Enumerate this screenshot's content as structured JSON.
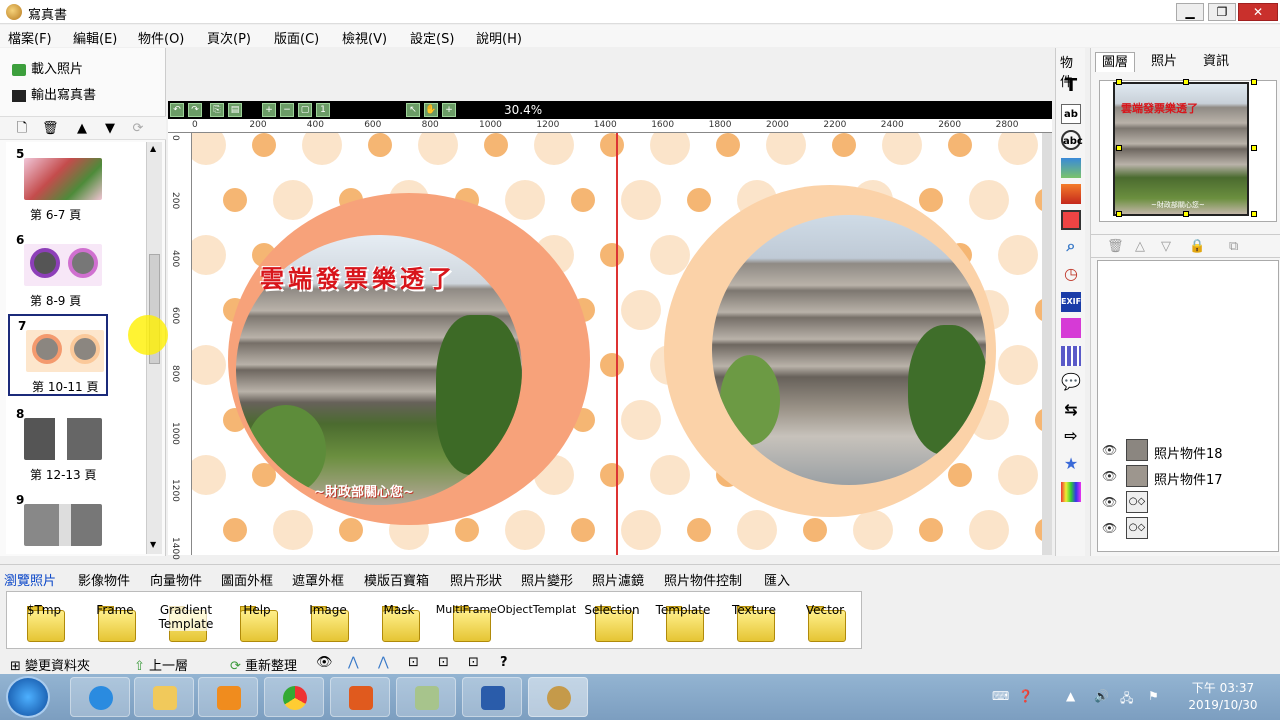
{
  "window": {
    "title": "寫真書"
  },
  "menu": [
    "檔案(F)",
    "編輯(E)",
    "物件(O)",
    "頁次(P)",
    "版面(C)",
    "檢視(V)",
    "設定(S)",
    "說明(H)"
  ],
  "left_actions": {
    "load_photos": "載入照片",
    "export_book": "輸出寫真書"
  },
  "pages": [
    {
      "num": "5",
      "label": "第 6-7 頁"
    },
    {
      "num": "6",
      "label": "第 8-9 頁"
    },
    {
      "num": "7",
      "label": "第 10-11 頁",
      "selected": true
    },
    {
      "num": "8",
      "label": "第 12-13 頁"
    },
    {
      "num": "9",
      "label": ""
    }
  ],
  "editor": {
    "zoom": "30.4%",
    "ruler_h": [
      "0",
      "200",
      "400",
      "600",
      "800",
      "1000",
      "1200",
      "1400",
      "1600",
      "1800",
      "2000",
      "2200",
      "2400",
      "2600",
      "2800"
    ],
    "ruler_v": [
      "0",
      "200",
      "400",
      "600",
      "800",
      "1000",
      "1200",
      "1400"
    ],
    "canvas_title": "雲端發票樂透了",
    "canvas_caption": "~財政部關心您~"
  },
  "right_tabs": [
    "圖層",
    "照片",
    "資訊"
  ],
  "preview": {
    "title": "雲端發票樂透了",
    "caption": "~財政部關心您~"
  },
  "layers": [
    {
      "name": "照片物件18"
    },
    {
      "name": "照片物件17"
    },
    {
      "name": ""
    },
    {
      "name": ""
    }
  ],
  "bottom_tabs": [
    "瀏覽照片",
    "影像物件",
    "向量物件",
    "圖面外框",
    "遮罩外框",
    "模版百寶箱",
    "照片形狀",
    "照片變形",
    "照片濾鏡",
    "照片物件控制",
    "匯入"
  ],
  "folders": [
    "$Tmp",
    "Frame",
    "Gradient Template",
    "Help",
    "Image",
    "Mask",
    "MultiFrameObjectTemplat",
    "Selection",
    "Template",
    "Texture",
    "Vector"
  ],
  "bottom_toolbar": {
    "change_folder": "變更資料夾",
    "up": "上一層",
    "refresh": "重新整理"
  },
  "clock": {
    "time": "下午 03:37",
    "date": "2019/10/30"
  },
  "colors": {
    "canvas_dot_orange": "#f3a95a",
    "canvas_dot_pale": "#fbe1c4",
    "frame_left": "#f7a27a",
    "frame_right": "#fbd2a8",
    "title_red": "#d8151b",
    "active_tab": "#0a46c8"
  }
}
